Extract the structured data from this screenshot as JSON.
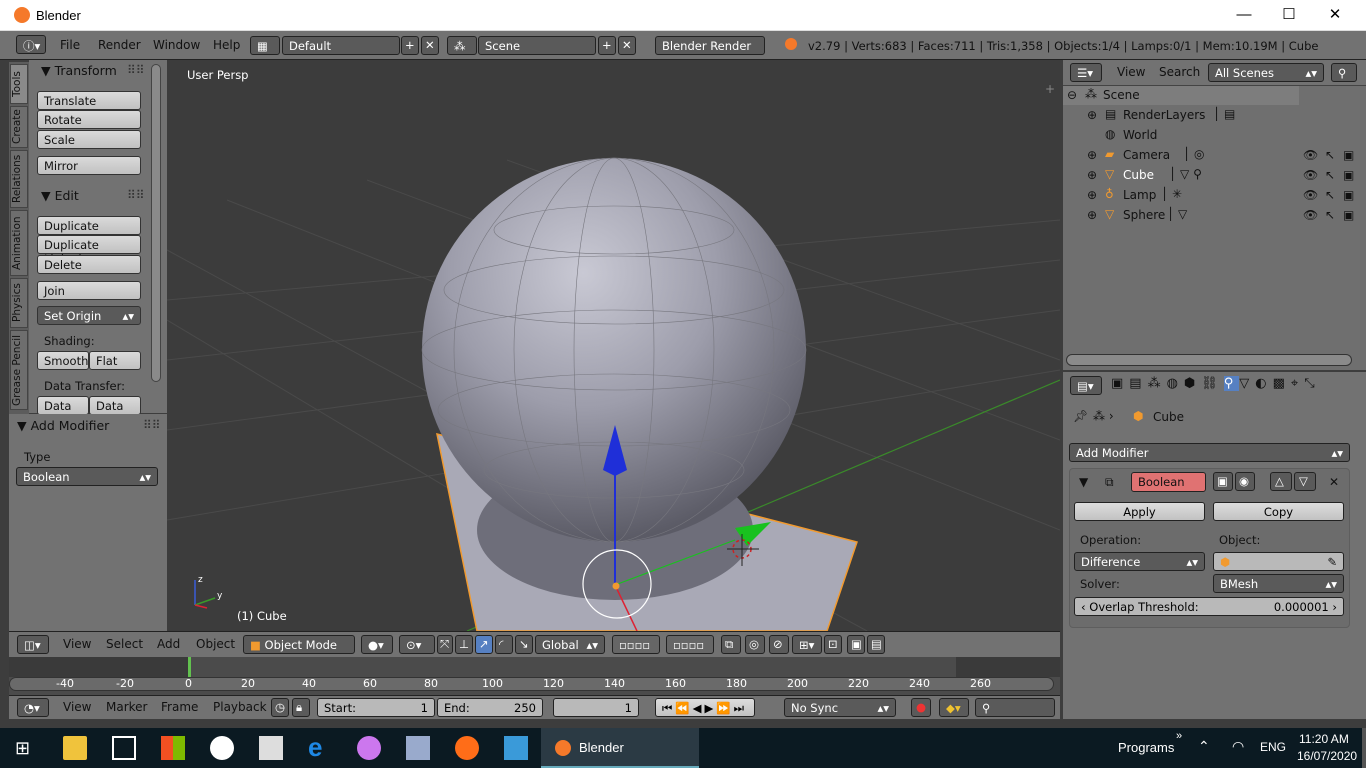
{
  "window": {
    "title": "Blender",
    "minimize": "—",
    "maximize": "☐",
    "close": "✕"
  },
  "info_header": {
    "menus": [
      "File",
      "Render",
      "Window",
      "Help"
    ],
    "layout": "Default",
    "scene": "Scene",
    "engine": "Blender Render",
    "stats": "v2.79 | Verts:683 | Faces:711 | Tris:1,358 | Objects:1/4 | Lamps:0/1 | Mem:10.19M | Cube"
  },
  "tool_tabs": [
    "Tools",
    "Create",
    "Relations",
    "Animation",
    "Physics",
    "Grease Pencil"
  ],
  "tool_shelf": {
    "transform_title": "Transform",
    "transform_buttons": [
      "Translate",
      "Rotate",
      "Scale"
    ],
    "mirror": "Mirror",
    "edit_title": "Edit",
    "edit_buttons": [
      "Duplicate",
      "Duplicate Linked",
      "Delete"
    ],
    "join": "Join",
    "set_origin": "Set Origin",
    "shading_label": "Shading:",
    "smooth": "Smooth",
    "flat": "Flat",
    "data_transfer_label": "Data Transfer:",
    "data": "Data",
    "data_la": "Data La"
  },
  "add_modifier_panel": {
    "title": "Add Modifier",
    "type_label": "Type",
    "type_value": "Boolean"
  },
  "viewport": {
    "view_name": "User Persp",
    "object_label": "(1) Cube"
  },
  "view3d_header": {
    "menus": [
      "View",
      "Select",
      "Add",
      "Object"
    ],
    "mode": "Object Mode",
    "orientation": "Global"
  },
  "timeline": {
    "ticks": [
      "-40",
      "-20",
      "0",
      "20",
      "40",
      "60",
      "80",
      "100",
      "120",
      "140",
      "160",
      "180",
      "200",
      "220",
      "240",
      "260"
    ],
    "menus": [
      "View",
      "Marker",
      "Frame",
      "Playback"
    ],
    "start_label": "Start:",
    "start_value": "1",
    "end_label": "End:",
    "end_value": "250",
    "current_frame": "1",
    "sync": "No Sync"
  },
  "outliner": {
    "header_menus": [
      "View",
      "Search"
    ],
    "filter": "All Scenes",
    "items": [
      "Scene",
      "RenderLayers",
      "World",
      "Camera",
      "Cube",
      "Lamp",
      "Sphere"
    ]
  },
  "properties": {
    "breadcrumb": "Cube",
    "add_modifier": "Add Modifier",
    "modifier_name": "Boolean",
    "apply": "Apply",
    "copy": "Copy",
    "operation_label": "Operation:",
    "operation_value": "Difference",
    "object_label": "Object:",
    "solver_label": "Solver:",
    "solver_value": "BMesh",
    "overlap_label": "Overlap Threshold:",
    "overlap_value": "0.000001"
  },
  "taskbar": {
    "active_app": "Blender",
    "programs": "Programs",
    "language": "ENG",
    "time": "11:20 AM",
    "date": "16/07/2020"
  },
  "colors": {
    "accent_blue": "#5680c2",
    "modifier_red": "#e07272",
    "selected_orange": "#f19a2f",
    "taskbar": "#0b1a22"
  }
}
